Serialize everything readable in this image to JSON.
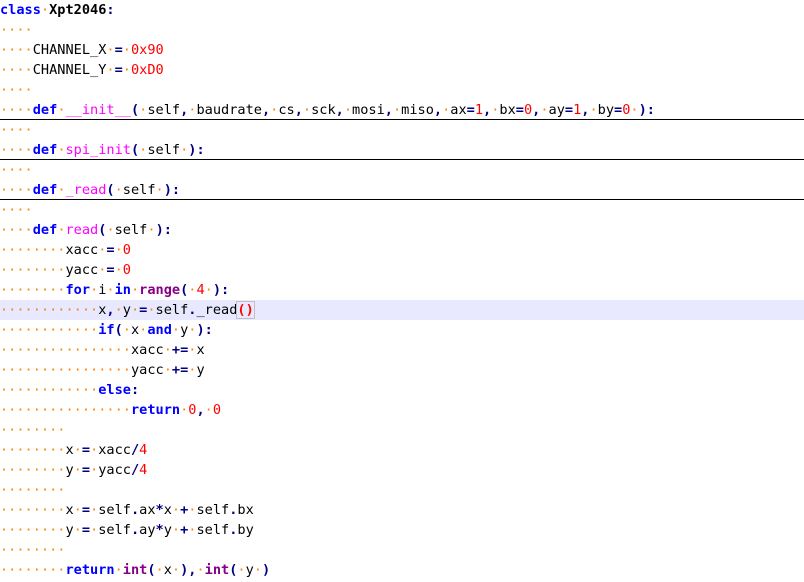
{
  "editor": {
    "language": "python",
    "current_line": 15,
    "colors": {
      "background": "#ffffff",
      "current_line": "#e8e8ff",
      "keyword": "#0000ff",
      "builtin": "#880088",
      "function_name": "#ff00ff",
      "number": "#ff0000",
      "operator": "#000080",
      "whitespace_marker": "#ff8000",
      "fold_line": "#000000"
    },
    "lines": [
      {
        "folded": false,
        "tokens": [
          [
            "kw",
            "class"
          ],
          [
            "ws",
            "·"
          ],
          [
            "cls",
            "Xpt2046"
          ],
          [
            "op",
            ":"
          ]
        ]
      },
      {
        "folded": false,
        "tokens": [
          [
            "ws",
            "····"
          ]
        ]
      },
      {
        "folded": false,
        "tokens": [
          [
            "ws",
            "····"
          ],
          [
            "id",
            "CHANNEL_X"
          ],
          [
            "ws",
            "·"
          ],
          [
            "op",
            "="
          ],
          [
            "ws",
            "·"
          ],
          [
            "num",
            "0x90"
          ]
        ]
      },
      {
        "folded": false,
        "tokens": [
          [
            "ws",
            "····"
          ],
          [
            "id",
            "CHANNEL_Y"
          ],
          [
            "ws",
            "·"
          ],
          [
            "op",
            "="
          ],
          [
            "ws",
            "·"
          ],
          [
            "num",
            "0xD0"
          ]
        ]
      },
      {
        "folded": false,
        "tokens": [
          [
            "ws",
            "····"
          ]
        ]
      },
      {
        "folded": true,
        "tokens": [
          [
            "ws",
            "····"
          ],
          [
            "kw",
            "def"
          ],
          [
            "ws",
            "·"
          ],
          [
            "fn",
            "__init__"
          ],
          [
            "op",
            "("
          ],
          [
            "ws",
            "·"
          ],
          [
            "id",
            "self"
          ],
          [
            "op",
            ","
          ],
          [
            "ws",
            "·"
          ],
          [
            "id",
            "baudrate"
          ],
          [
            "op",
            ","
          ],
          [
            "ws",
            "·"
          ],
          [
            "id",
            "cs"
          ],
          [
            "op",
            ","
          ],
          [
            "ws",
            "·"
          ],
          [
            "id",
            "sck"
          ],
          [
            "op",
            ","
          ],
          [
            "ws",
            "·"
          ],
          [
            "id",
            "mosi"
          ],
          [
            "op",
            ","
          ],
          [
            "ws",
            "·"
          ],
          [
            "id",
            "miso"
          ],
          [
            "op",
            ","
          ],
          [
            "ws",
            "·"
          ],
          [
            "id",
            "ax"
          ],
          [
            "op",
            "="
          ],
          [
            "num",
            "1"
          ],
          [
            "op",
            ","
          ],
          [
            "ws",
            "·"
          ],
          [
            "id",
            "bx"
          ],
          [
            "op",
            "="
          ],
          [
            "num",
            "0"
          ],
          [
            "op",
            ","
          ],
          [
            "ws",
            "·"
          ],
          [
            "id",
            "ay"
          ],
          [
            "op",
            "="
          ],
          [
            "num",
            "1"
          ],
          [
            "op",
            ","
          ],
          [
            "ws",
            "·"
          ],
          [
            "id",
            "by"
          ],
          [
            "op",
            "="
          ],
          [
            "num",
            "0"
          ],
          [
            "ws",
            "·"
          ],
          [
            "op",
            "):"
          ]
        ]
      },
      {
        "folded": false,
        "tokens": [
          [
            "ws",
            "····"
          ]
        ]
      },
      {
        "folded": true,
        "tokens": [
          [
            "ws",
            "····"
          ],
          [
            "kw",
            "def"
          ],
          [
            "ws",
            "·"
          ],
          [
            "fn",
            "spi_init"
          ],
          [
            "op",
            "("
          ],
          [
            "ws",
            "·"
          ],
          [
            "id",
            "self"
          ],
          [
            "ws",
            "·"
          ],
          [
            "op",
            "):"
          ]
        ]
      },
      {
        "folded": false,
        "tokens": [
          [
            "ws",
            "····"
          ]
        ]
      },
      {
        "folded": true,
        "tokens": [
          [
            "ws",
            "····"
          ],
          [
            "kw",
            "def"
          ],
          [
            "ws",
            "·"
          ],
          [
            "fn",
            "_read"
          ],
          [
            "op",
            "("
          ],
          [
            "ws",
            "·"
          ],
          [
            "id",
            "self"
          ],
          [
            "ws",
            "·"
          ],
          [
            "op",
            "):"
          ]
        ]
      },
      {
        "folded": false,
        "tokens": [
          [
            "ws",
            "····"
          ]
        ]
      },
      {
        "folded": false,
        "tokens": [
          [
            "ws",
            "····"
          ],
          [
            "kw",
            "def"
          ],
          [
            "ws",
            "·"
          ],
          [
            "fn",
            "read"
          ],
          [
            "op",
            "("
          ],
          [
            "ws",
            "·"
          ],
          [
            "id",
            "self"
          ],
          [
            "ws",
            "·"
          ],
          [
            "op",
            "):"
          ]
        ]
      },
      {
        "folded": false,
        "tokens": [
          [
            "ws",
            "········"
          ],
          [
            "id",
            "xacc"
          ],
          [
            "ws",
            "·"
          ],
          [
            "op",
            "="
          ],
          [
            "ws",
            "·"
          ],
          [
            "num",
            "0"
          ]
        ]
      },
      {
        "folded": false,
        "tokens": [
          [
            "ws",
            "········"
          ],
          [
            "id",
            "yacc"
          ],
          [
            "ws",
            "·"
          ],
          [
            "op",
            "="
          ],
          [
            "ws",
            "·"
          ],
          [
            "num",
            "0"
          ]
        ]
      },
      {
        "folded": false,
        "tokens": [
          [
            "ws",
            "········"
          ],
          [
            "kw",
            "for"
          ],
          [
            "ws",
            "·"
          ],
          [
            "id",
            "i"
          ],
          [
            "ws",
            "·"
          ],
          [
            "kw",
            "in"
          ],
          [
            "ws",
            "·"
          ],
          [
            "bi",
            "range"
          ],
          [
            "op",
            "("
          ],
          [
            "ws",
            "·"
          ],
          [
            "num",
            "4"
          ],
          [
            "ws",
            "·"
          ],
          [
            "op",
            "):"
          ]
        ]
      },
      {
        "folded": false,
        "tokens": [
          [
            "ws",
            "············"
          ],
          [
            "id",
            "x"
          ],
          [
            "op",
            ","
          ],
          [
            "ws",
            "·"
          ],
          [
            "id",
            "y"
          ],
          [
            "ws",
            "·"
          ],
          [
            "op",
            "="
          ],
          [
            "ws",
            "·"
          ],
          [
            "id",
            "self"
          ],
          [
            "op",
            "."
          ],
          [
            "id",
            "_read"
          ],
          [
            "brace",
            "()"
          ]
        ]
      },
      {
        "folded": false,
        "tokens": [
          [
            "ws",
            "············"
          ],
          [
            "kw",
            "if"
          ],
          [
            "op",
            "("
          ],
          [
            "ws",
            "·"
          ],
          [
            "id",
            "x"
          ],
          [
            "ws",
            "·"
          ],
          [
            "kw",
            "and"
          ],
          [
            "ws",
            "·"
          ],
          [
            "id",
            "y"
          ],
          [
            "ws",
            "·"
          ],
          [
            "op",
            "):"
          ]
        ]
      },
      {
        "folded": false,
        "tokens": [
          [
            "ws",
            "················"
          ],
          [
            "id",
            "xacc"
          ],
          [
            "ws",
            "·"
          ],
          [
            "op",
            "+="
          ],
          [
            "ws",
            "·"
          ],
          [
            "id",
            "x"
          ]
        ]
      },
      {
        "folded": false,
        "tokens": [
          [
            "ws",
            "················"
          ],
          [
            "id",
            "yacc"
          ],
          [
            "ws",
            "·"
          ],
          [
            "op",
            "+="
          ],
          [
            "ws",
            "·"
          ],
          [
            "id",
            "y"
          ]
        ]
      },
      {
        "folded": false,
        "tokens": [
          [
            "ws",
            "············"
          ],
          [
            "kw",
            "else"
          ],
          [
            "op",
            ":"
          ]
        ]
      },
      {
        "folded": false,
        "tokens": [
          [
            "ws",
            "················"
          ],
          [
            "kw",
            "return"
          ],
          [
            "ws",
            "·"
          ],
          [
            "num",
            "0"
          ],
          [
            "op",
            ","
          ],
          [
            "ws",
            "·"
          ],
          [
            "num",
            "0"
          ]
        ]
      },
      {
        "folded": false,
        "tokens": [
          [
            "ws",
            "········"
          ]
        ]
      },
      {
        "folded": false,
        "tokens": [
          [
            "ws",
            "········"
          ],
          [
            "id",
            "x"
          ],
          [
            "ws",
            "·"
          ],
          [
            "op",
            "="
          ],
          [
            "ws",
            "·"
          ],
          [
            "id",
            "xacc"
          ],
          [
            "op",
            "/"
          ],
          [
            "num",
            "4"
          ]
        ]
      },
      {
        "folded": false,
        "tokens": [
          [
            "ws",
            "········"
          ],
          [
            "id",
            "y"
          ],
          [
            "ws",
            "·"
          ],
          [
            "op",
            "="
          ],
          [
            "ws",
            "·"
          ],
          [
            "id",
            "yacc"
          ],
          [
            "op",
            "/"
          ],
          [
            "num",
            "4"
          ]
        ]
      },
      {
        "folded": false,
        "tokens": [
          [
            "ws",
            "········"
          ]
        ]
      },
      {
        "folded": false,
        "tokens": [
          [
            "ws",
            "········"
          ],
          [
            "id",
            "x"
          ],
          [
            "ws",
            "·"
          ],
          [
            "op",
            "="
          ],
          [
            "ws",
            "·"
          ],
          [
            "id",
            "self"
          ],
          [
            "op",
            "."
          ],
          [
            "id",
            "ax"
          ],
          [
            "op",
            "*"
          ],
          [
            "id",
            "x"
          ],
          [
            "ws",
            "·"
          ],
          [
            "op",
            "+"
          ],
          [
            "ws",
            "·"
          ],
          [
            "id",
            "self"
          ],
          [
            "op",
            "."
          ],
          [
            "id",
            "bx"
          ]
        ]
      },
      {
        "folded": false,
        "tokens": [
          [
            "ws",
            "········"
          ],
          [
            "id",
            "y"
          ],
          [
            "ws",
            "·"
          ],
          [
            "op",
            "="
          ],
          [
            "ws",
            "·"
          ],
          [
            "id",
            "self"
          ],
          [
            "op",
            "."
          ],
          [
            "id",
            "ay"
          ],
          [
            "op",
            "*"
          ],
          [
            "id",
            "y"
          ],
          [
            "ws",
            "·"
          ],
          [
            "op",
            "+"
          ],
          [
            "ws",
            "·"
          ],
          [
            "id",
            "self"
          ],
          [
            "op",
            "."
          ],
          [
            "id",
            "by"
          ]
        ]
      },
      {
        "folded": false,
        "tokens": [
          [
            "ws",
            "········"
          ]
        ]
      },
      {
        "folded": false,
        "tokens": [
          [
            "ws",
            "········"
          ],
          [
            "kw",
            "return"
          ],
          [
            "ws",
            "·"
          ],
          [
            "bi",
            "int"
          ],
          [
            "op",
            "("
          ],
          [
            "ws",
            "·"
          ],
          [
            "id",
            "x"
          ],
          [
            "ws",
            "·"
          ],
          [
            "op",
            "),"
          ],
          [
            "ws",
            "·"
          ],
          [
            "bi",
            "int"
          ],
          [
            "op",
            "("
          ],
          [
            "ws",
            "·"
          ],
          [
            "id",
            "y"
          ],
          [
            "ws",
            "·"
          ],
          [
            "op",
            ")"
          ]
        ]
      }
    ]
  }
}
